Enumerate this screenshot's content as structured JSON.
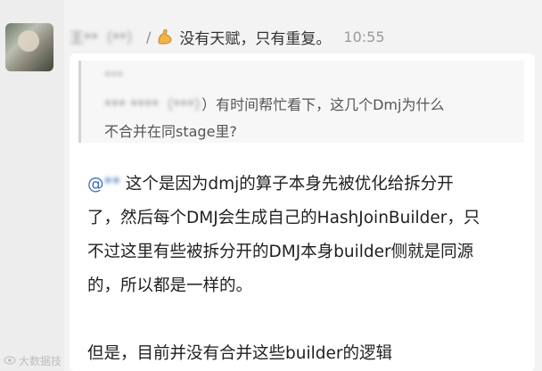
{
  "sender": {
    "name": "王**（**）",
    "separator": "/",
    "status_icon": "flexed-bicep-icon",
    "status_text": "没有天赋，只有重复。",
    "time": "10:55"
  },
  "quote": {
    "author": "***",
    "prefix_blurred": "*** ****（***）",
    "line1_rest": "）有时间帮忙看下，这几个Dmj为什么",
    "line2": "不合并在同stage里?"
  },
  "reply": {
    "mention_at": "@",
    "mention_name": "**",
    "line1_rest": " 这个是因为dmj的算子本身先被优化给拆分开",
    "line2": "了，然后每个DMJ会生成自己的HashJoinBuilder，只",
    "line3": "不过这里有些被拆分开的DMJ本身builder侧就是同源",
    "line4": "的，所以都是一样的。",
    "line5": "但是，目前并没有合并这些builder的逻辑"
  },
  "watermark": {
    "icon": "eye-icon",
    "text": "大数据技"
  },
  "colors": {
    "background": "#f3f3f3",
    "bubble": "#ffffff",
    "mention": "#3a6fb8",
    "time": "#9a9a9a"
  }
}
